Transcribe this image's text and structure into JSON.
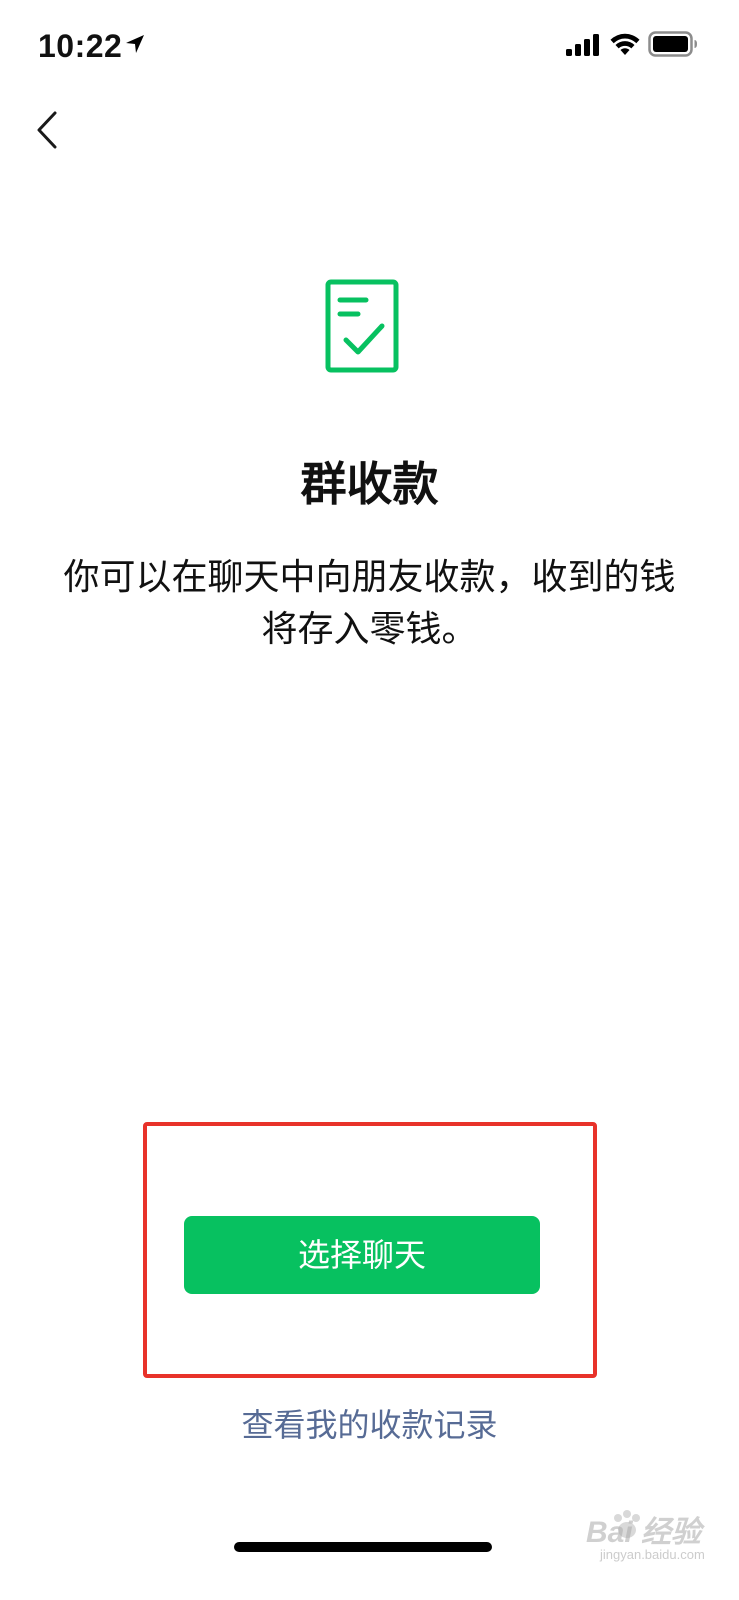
{
  "status_bar": {
    "time": "10:22",
    "icons": [
      "location-arrow-icon",
      "cellular-signal-icon",
      "wifi-icon",
      "battery-icon"
    ]
  },
  "nav": {
    "back_icon": "chevron-left-icon"
  },
  "main": {
    "icon": "checklist-document-icon",
    "title": "群收款",
    "description": "你可以在聊天中向朋友收款，收到的钱将存入零钱。",
    "primary_button_label": "选择聊天",
    "records_link_label": "查看我的收款记录"
  },
  "watermark": {
    "text": "Bai 经验",
    "sub": "jingyan.baidu.com"
  },
  "colors": {
    "accent_green": "#07c160",
    "link_blue": "#576b95",
    "highlight_red": "#e8322a",
    "text": "#111111",
    "background": "#ffffff"
  }
}
